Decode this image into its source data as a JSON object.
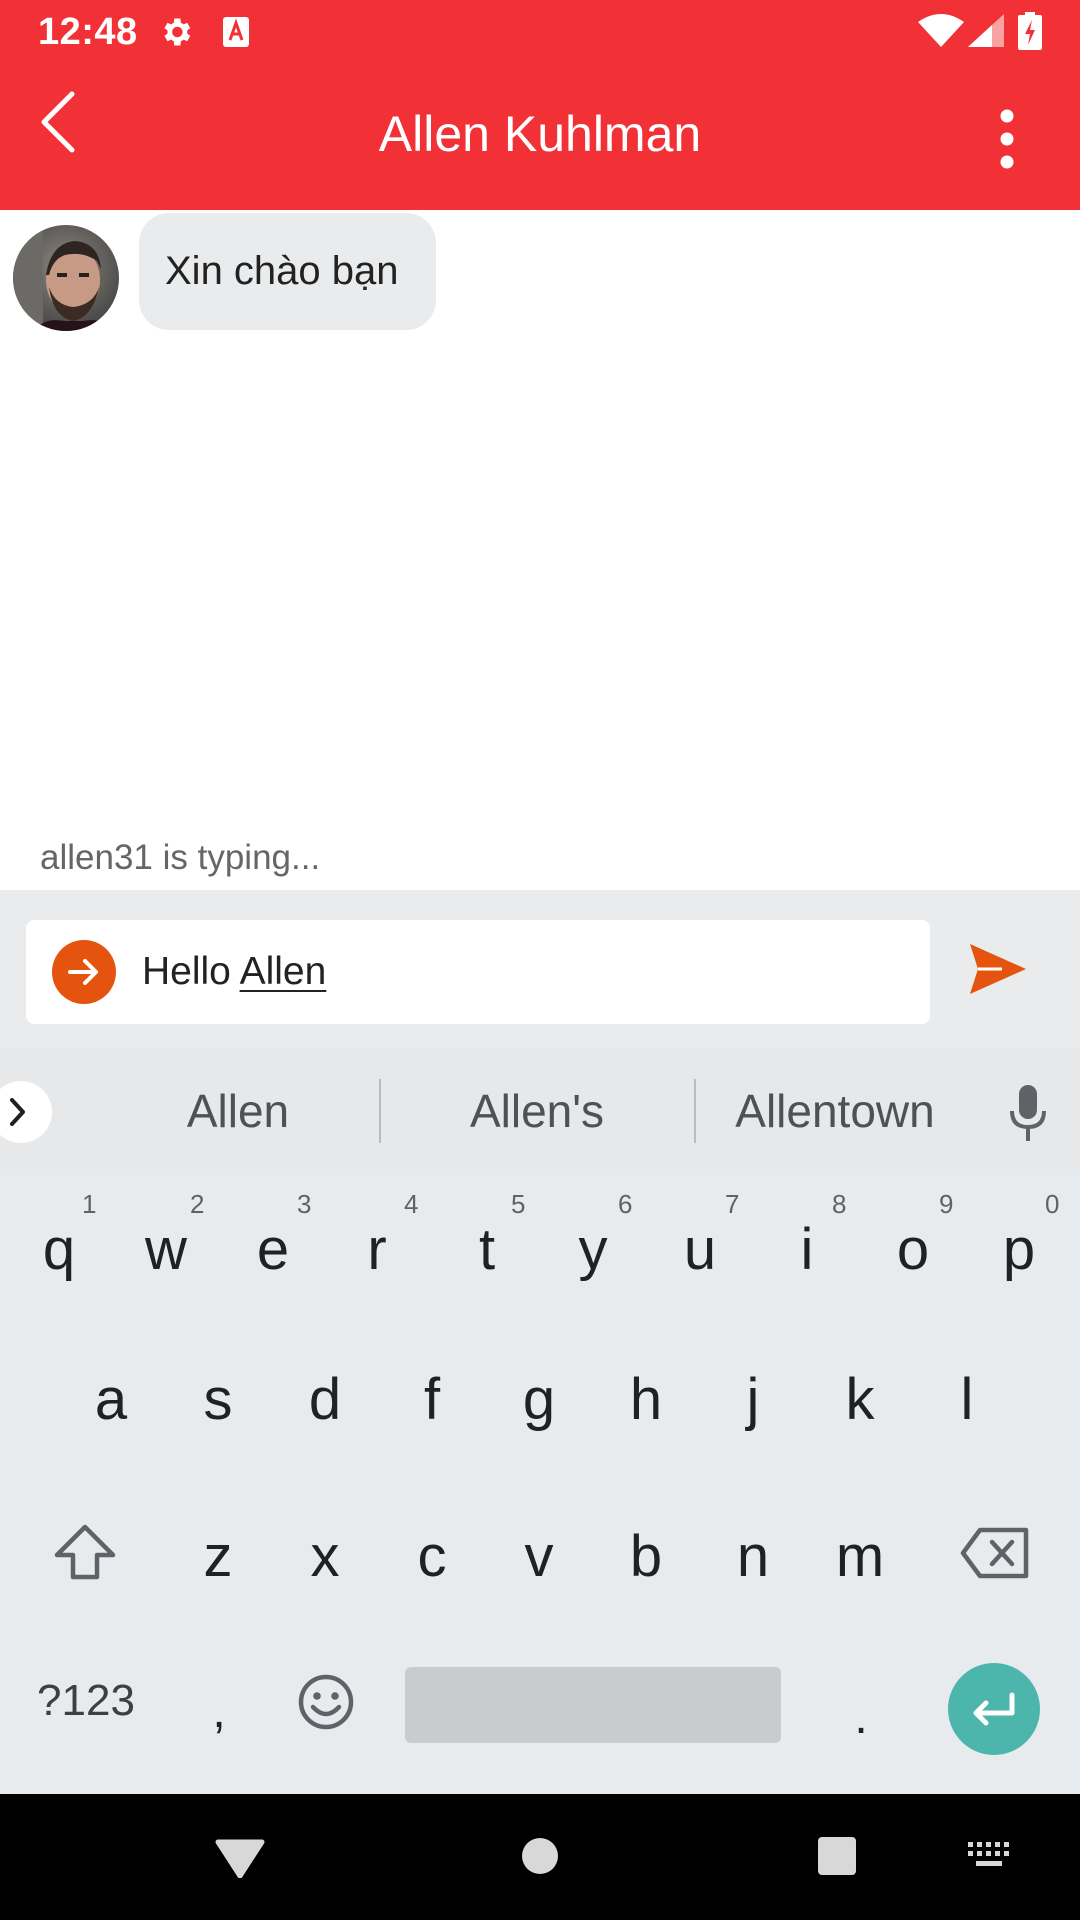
{
  "status_bar": {
    "time": "12:48",
    "icons": [
      "settings-icon",
      "font-a-icon",
      "wifi-icon",
      "signal-icon",
      "battery-charging-icon"
    ]
  },
  "app_bar": {
    "title": "Allen Kuhlman",
    "back_icon": "chevron-left-icon",
    "menu_icon": "more-vert-icon"
  },
  "messages": [
    {
      "avatar": "user-avatar",
      "text": "Xin chào bạn"
    }
  ],
  "typing_indicator": "allen31 is typing...",
  "composer": {
    "value_prefix": "Hello ",
    "value_composing": "Allen",
    "attach_icon": "arrow-right-circle-icon",
    "send_icon": "send-icon",
    "accent_color": "#e4540f"
  },
  "keyboard": {
    "suggestions": [
      "Allen",
      "Allen's",
      "Allentown"
    ],
    "row1": [
      "q",
      "w",
      "e",
      "r",
      "t",
      "y",
      "u",
      "i",
      "o",
      "p"
    ],
    "row1_hints": [
      "1",
      "2",
      "3",
      "4",
      "5",
      "6",
      "7",
      "8",
      "9",
      "0"
    ],
    "row2": [
      "a",
      "s",
      "d",
      "f",
      "g",
      "h",
      "j",
      "k",
      "l"
    ],
    "row3": [
      "z",
      "x",
      "c",
      "v",
      "b",
      "n",
      "m"
    ],
    "symbols_key": "?123",
    "comma_key": ",",
    "period_key": ".",
    "enter_color": "#4db6ac"
  },
  "colors": {
    "header": "#f23137",
    "bubble": "#e9ebec"
  }
}
